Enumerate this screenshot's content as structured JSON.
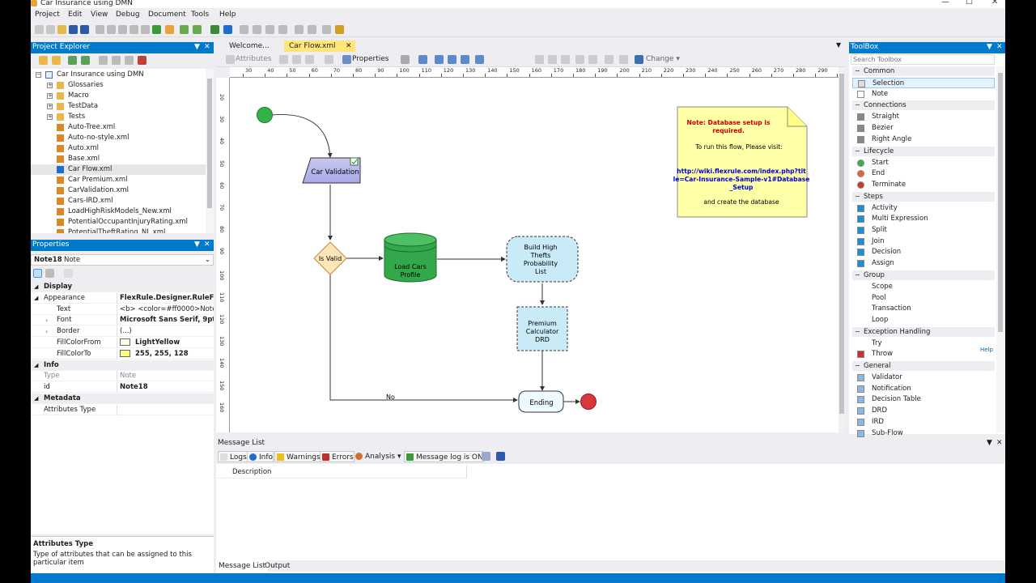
{
  "window": {
    "title": "Car Insurance using DMN"
  },
  "menu": [
    "Project",
    "Edit",
    "View",
    "Debug",
    "Document",
    "Tools",
    "Help"
  ],
  "project_explorer": {
    "title": "Project Explorer",
    "root": "Car Insurance using DMN",
    "items": [
      {
        "label": "Glossaries",
        "kind": "folder"
      },
      {
        "label": "Macro",
        "kind": "folder"
      },
      {
        "label": "TestData",
        "kind": "folder"
      },
      {
        "label": "Tests",
        "kind": "folder"
      },
      {
        "label": "Auto-Tree.xml",
        "kind": "file"
      },
      {
        "label": "Auto-no-style.xml",
        "kind": "file"
      },
      {
        "label": "Auto.xml",
        "kind": "file"
      },
      {
        "label": "Base.xml",
        "kind": "file"
      },
      {
        "label": "Car Flow.xml",
        "kind": "flow"
      },
      {
        "label": "Car Premium.xml",
        "kind": "file"
      },
      {
        "label": "CarValidation.xml",
        "kind": "file"
      },
      {
        "label": "Cars-IRD.xml",
        "kind": "file"
      },
      {
        "label": "LoadHighRiskModels_New.xml",
        "kind": "file"
      },
      {
        "label": "PotentialOccupantInjuryRating.xml",
        "kind": "file"
      },
      {
        "label": "PotentialTheftRating_NL.xml",
        "kind": "file"
      }
    ]
  },
  "properties": {
    "title": "Properties",
    "object": "Note18",
    "object_type": "Note",
    "rows": [
      {
        "cat": true,
        "k": "Display",
        "v": ""
      },
      {
        "cat": false,
        "k": "Appearance",
        "v": "FlexRule.Designer.RuleFlow.Note",
        "bold": true
      },
      {
        "cat": false,
        "k": "Text",
        "v": "<b> <color=#ff0000>Note: Datab",
        "bold": false
      },
      {
        "cat": false,
        "k": "Font",
        "v": "Microsoft Sans Serif, 9pt",
        "bold": true
      },
      {
        "cat": false,
        "k": "Border",
        "v": "(...)",
        "bold": false
      },
      {
        "cat": false,
        "k": "FillColorFrom",
        "v": "LightYellow",
        "bold": true,
        "swatch": "#ffffe0"
      },
      {
        "cat": false,
        "k": "FillColorTo",
        "v": "255, 255, 128",
        "bold": true,
        "swatch": "#ffff80"
      },
      {
        "cat": true,
        "k": "Info",
        "v": ""
      },
      {
        "cat": false,
        "k": "Type",
        "v": "Note",
        "gray": true
      },
      {
        "cat": false,
        "k": "id",
        "v": "Note18",
        "bold": true
      },
      {
        "cat": true,
        "k": "Metadata",
        "v": ""
      },
      {
        "cat": false,
        "k": "Attributes Type",
        "v": ""
      }
    ],
    "help_title": "Attributes Type",
    "help_text": "Type of attributes that can be assigned to this particular item"
  },
  "editor": {
    "tabs": [
      "Welcome...",
      "Car Flow.xml"
    ],
    "toolbar": {
      "attributes": "Attributes",
      "properties": "Properties",
      "change": "Change"
    },
    "ruler_h": [
      "30",
      "40",
      "50",
      "60",
      "70",
      "80",
      "90",
      "100",
      "110",
      "120",
      "130",
      "140",
      "150",
      "160",
      "170",
      "180",
      "190",
      "200",
      "210",
      "220",
      "230",
      "240",
      "250",
      "260",
      "270",
      "280",
      "290",
      "300"
    ],
    "ruler_v": [
      "20",
      "30",
      "40",
      "50",
      "60",
      "70",
      "80",
      "90",
      "100",
      "110",
      "120",
      "130",
      "140",
      "150",
      "160"
    ],
    "nodes": {
      "car_validation": "Car Validation",
      "is_valid": "Is Valid",
      "load_cars": "Load Cars\nProfile",
      "build_list": "Build High\nThefts\nProbability\nList",
      "premium": "Premium\nCalculator\nDRD",
      "ending": "Ending",
      "no_label": "No"
    },
    "note": {
      "heading": "Note:  Database  setup  is required.",
      "line1": "To run this flow, Please visit:",
      "link": "http://wiki.flexrule.com/index.php?title=Car-Insurance-Sample-v1#Database_Setup",
      "line2": "and create the database",
      "heading_color": "#cc0000",
      "link_color": "#0000cc"
    }
  },
  "toolbox": {
    "title": "ToolBox",
    "search_placeholder": "Search Toolbox",
    "help": "Help",
    "groups": [
      {
        "name": "Common",
        "items": [
          "Selection",
          "Note"
        ]
      },
      {
        "name": "Connections",
        "items": [
          "Straight",
          "Bezier",
          "Right Angle"
        ]
      },
      {
        "name": "Lifecycle",
        "items": [
          "Start",
          "End",
          "Terminate"
        ]
      },
      {
        "name": "Steps",
        "items": [
          "Activity",
          "Multi Expression",
          "Split",
          "Join",
          "Decision",
          "Assign"
        ]
      },
      {
        "name": "Group",
        "items": [
          "Scope",
          "Pool",
          "Transaction",
          "Loop"
        ]
      },
      {
        "name": "Exception Handling",
        "items": [
          "Try",
          "Throw"
        ]
      },
      {
        "name": "General",
        "items": [
          "Validator",
          "Notification",
          "Decision Table",
          "DRD",
          "IRD",
          "Sub-Flow"
        ]
      }
    ]
  },
  "message_list": {
    "title": "Message List",
    "buttons": [
      "Logs",
      "Info",
      "Warnings",
      "Errors",
      "Analysis",
      "Message log is ON"
    ],
    "column": "Description"
  },
  "bottom_tabs": [
    "Message List",
    "Output"
  ]
}
